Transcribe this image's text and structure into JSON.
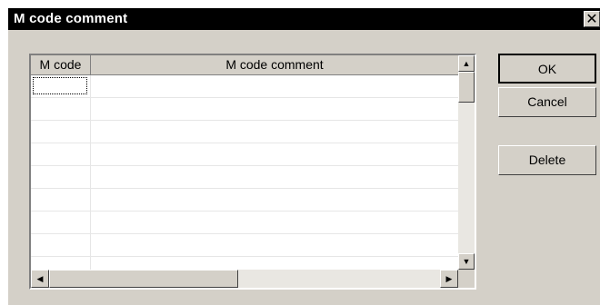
{
  "window": {
    "title": "M code comment",
    "close_glyph": "✕"
  },
  "grid": {
    "columns": [
      "M code",
      "M code comment"
    ],
    "rows": [
      {
        "m_code": "",
        "comment": ""
      },
      {
        "m_code": "",
        "comment": ""
      },
      {
        "m_code": "",
        "comment": ""
      },
      {
        "m_code": "",
        "comment": ""
      },
      {
        "m_code": "",
        "comment": ""
      },
      {
        "m_code": "",
        "comment": ""
      },
      {
        "m_code": "",
        "comment": ""
      },
      {
        "m_code": "",
        "comment": ""
      },
      {
        "m_code": "",
        "comment": ""
      }
    ]
  },
  "scroll": {
    "up": "▲",
    "down": "▼",
    "left": "◀",
    "right": "▶"
  },
  "buttons": {
    "ok": "OK",
    "cancel": "Cancel",
    "delete": "Delete"
  }
}
